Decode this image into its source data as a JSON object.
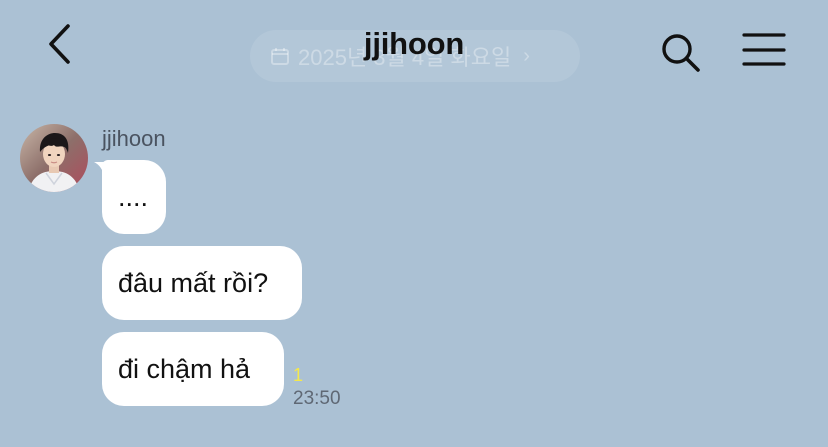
{
  "header": {
    "title": "jjihoon",
    "date_pill": "2025년 3월 4일 화요일",
    "date_pill_chevron": "›"
  },
  "messages": {
    "sender_name": "jjihoon",
    "bubbles": [
      {
        "text": "...."
      },
      {
        "text": "đâu mất rồi?"
      },
      {
        "text": "đi chậm hả"
      }
    ],
    "unread_count": "1",
    "time": "23:50"
  },
  "colors": {
    "background": "#abc1d4",
    "bubble": "#ffffff",
    "unread": "#f5e84a"
  }
}
